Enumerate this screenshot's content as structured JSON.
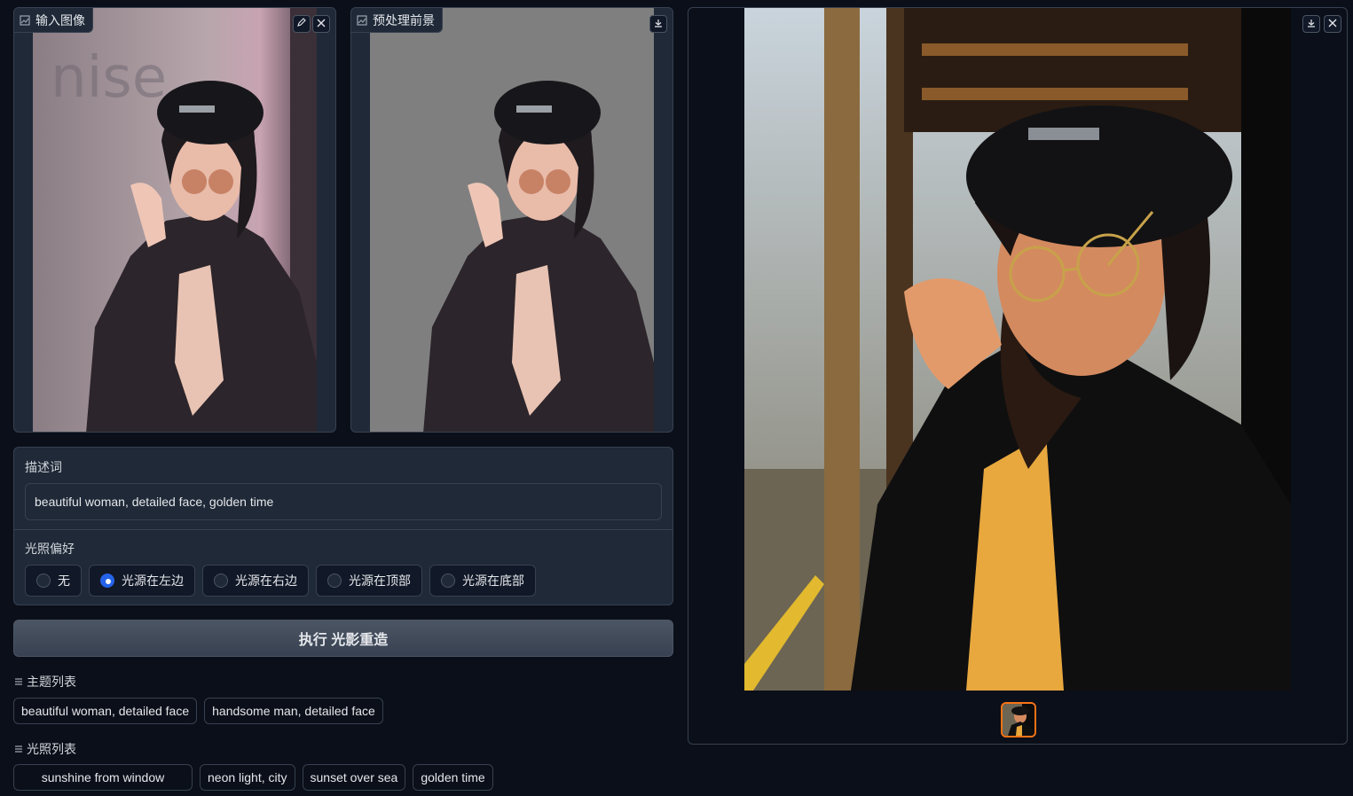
{
  "input_panel": {
    "label": "输入图像",
    "icon": "image-icon",
    "edit_icon": "pencil-icon",
    "close_icon": "close-icon"
  },
  "foreground_panel": {
    "label": "预处理前景",
    "icon": "image-icon",
    "download_icon": "download-icon"
  },
  "prompt": {
    "label": "描述词",
    "value": "beautiful woman, detailed face, golden time"
  },
  "lighting": {
    "label": "光照偏好",
    "options": [
      "无",
      "光源在左边",
      "光源在右边",
      "光源在顶部",
      "光源在底部"
    ],
    "selected": "光源在左边"
  },
  "run_button": {
    "label": "执行 光影重造"
  },
  "subject_list": {
    "title": "主题列表",
    "icon": "list-icon",
    "items": [
      "beautiful woman, detailed face",
      "handsome man, detailed face"
    ]
  },
  "lighting_list": {
    "title": "光照列表",
    "icon": "list-icon",
    "items": [
      "sunshine from window",
      "neon light, city",
      "sunset over sea",
      "golden time"
    ]
  },
  "output_panel": {
    "download_icon": "download-icon",
    "close_icon": "close-icon"
  },
  "colors": {
    "accent": "#f97316",
    "radio_selected": "#2563eb",
    "background": "#0b0f19",
    "panel": "#1f2937"
  }
}
